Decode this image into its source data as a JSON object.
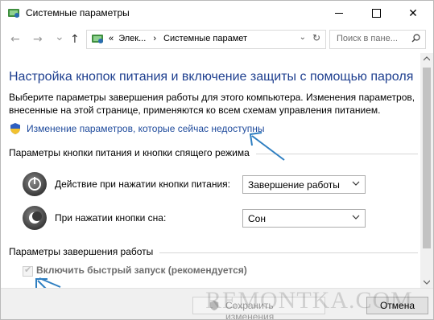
{
  "window": {
    "title": "Системные параметры",
    "controls": {
      "minimize": "minimize",
      "maximize": "maximize",
      "close": "✕"
    }
  },
  "nav": {
    "back": "←",
    "forward": "→",
    "history": "⌄",
    "up": "↑",
    "breadcrumb": {
      "prefix": "«",
      "item1": "Элек...",
      "separator": "›",
      "item2": "Системные парамет"
    },
    "dropdown_icon": "⌄",
    "refresh_icon": "↻",
    "search_placeholder": "Поиск в пане..."
  },
  "content": {
    "heading": "Настройка кнопок питания и включение защиты с помощью пароля",
    "description": "Выберите параметры завершения работы для этого компьютера. Изменения параметров, внесенные на этой странице, применяются ко всем схемам управления питанием.",
    "change_link": "Изменение параметров, которые сейчас недоступны",
    "power_section": {
      "title": "Параметры кнопки питания и кнопки спящего режима",
      "power_button": {
        "label": "Действие при нажатии кнопки питания:",
        "value": "Завершение работы"
      },
      "sleep_button": {
        "label": "При нажатии кнопки сна:",
        "value": "Сон"
      }
    },
    "shutdown_section": {
      "title": "Параметры завершения работы",
      "fast_startup": {
        "label": "Включить быстрый запуск (рекомендуется)",
        "checked": true,
        "enabled": false
      }
    }
  },
  "footer": {
    "save_label": "Сохранить изменения",
    "cancel_label": "Отмена"
  },
  "watermark": "REMONTKA.COM",
  "colors": {
    "heading": "#1e3f8f",
    "link": "#1e4a9c",
    "annotation_arrow": "#2f7fc1"
  },
  "icons": {
    "app": "control-panel-icon",
    "shield": "uac-shield-icon",
    "power": "power-icon",
    "sleep": "sleep-icon"
  }
}
